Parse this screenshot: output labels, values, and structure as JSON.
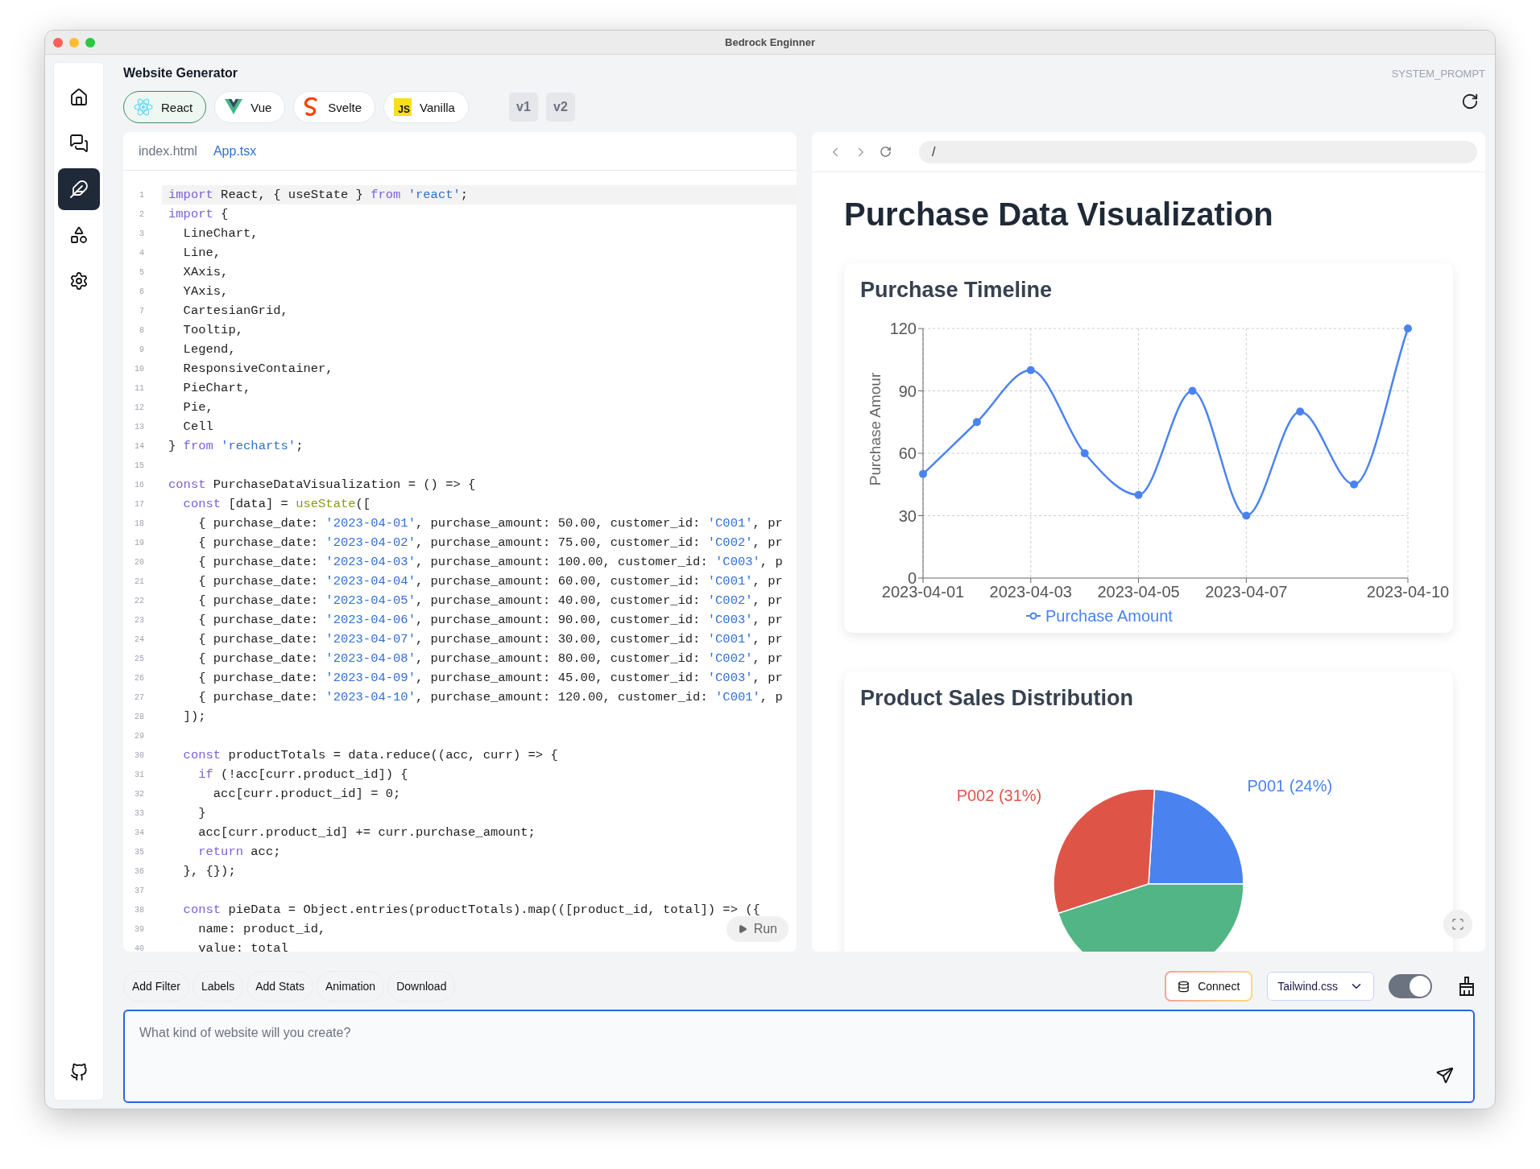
{
  "window": {
    "title": "Bedrock Enginner"
  },
  "sidebar": {
    "items": [
      {
        "selected": false
      },
      {
        "selected": false
      },
      {
        "selected": true
      },
      {
        "selected": false
      },
      {
        "selected": false
      }
    ]
  },
  "header": {
    "title": "Website Generator",
    "system_prompt": "SYSTEM_PROMPT"
  },
  "framework_tabs": [
    {
      "label": "React",
      "selected": true
    },
    {
      "label": "Vue",
      "selected": false
    },
    {
      "label": "Svelte",
      "selected": false
    },
    {
      "label": "Vanilla",
      "selected": false,
      "logo_text": "JS"
    }
  ],
  "versions": [
    "v1",
    "v2"
  ],
  "editor": {
    "files": [
      {
        "label": "index.html",
        "selected": false
      },
      {
        "label": "App.tsx",
        "selected": true
      }
    ],
    "lines": [
      {
        "n": "1",
        "active": true,
        "tokens": [
          {
            "kw": "import"
          },
          {
            "p": " React, { useState } "
          },
          {
            "kw": "from"
          },
          {
            "str": " 'react'"
          },
          {
            "p": ";"
          }
        ]
      },
      {
        "n": "2",
        "active": false,
        "tokens": [
          {
            "kw": "import"
          },
          {
            "p": " {"
          }
        ]
      },
      {
        "n": "3",
        "active": false,
        "tokens": [
          {
            "p": "  LineChart,"
          }
        ]
      },
      {
        "n": "4",
        "active": false,
        "tokens": [
          {
            "p": "  Line,"
          }
        ]
      },
      {
        "n": "5",
        "active": false,
        "tokens": [
          {
            "p": "  XAxis,"
          }
        ]
      },
      {
        "n": "6",
        "active": false,
        "tokens": [
          {
            "p": "  YAxis,"
          }
        ]
      },
      {
        "n": "7",
        "active": false,
        "tokens": [
          {
            "p": "  CartesianGrid,"
          }
        ]
      },
      {
        "n": "8",
        "active": false,
        "tokens": [
          {
            "p": "  Tooltip,"
          }
        ]
      },
      {
        "n": "9",
        "active": false,
        "tokens": [
          {
            "p": "  Legend,"
          }
        ]
      },
      {
        "n": "10",
        "active": false,
        "tokens": [
          {
            "p": "  ResponsiveContainer,"
          }
        ]
      },
      {
        "n": "11",
        "active": false,
        "tokens": [
          {
            "p": "  PieChart,"
          }
        ]
      },
      {
        "n": "12",
        "active": false,
        "tokens": [
          {
            "p": "  Pie,"
          }
        ]
      },
      {
        "n": "13",
        "active": false,
        "tokens": [
          {
            "p": "  Cell"
          }
        ]
      },
      {
        "n": "14",
        "active": false,
        "tokens": [
          {
            "p": "} "
          },
          {
            "kw": "from"
          },
          {
            "str": " 'recharts'"
          },
          {
            "p": ";"
          }
        ]
      },
      {
        "n": "15",
        "active": false
      },
      {
        "n": "16",
        "active": false,
        "tokens": [
          {
            "kw": "const"
          },
          {
            "p": " PurchaseDataVisualization = () => {"
          }
        ]
      },
      {
        "n": "17",
        "active": false,
        "tokens": [
          {
            "kw": "  const"
          },
          {
            "p": " [data] = "
          },
          {
            "fn": "useState"
          },
          {
            "p": "(["
          }
        ]
      },
      {
        "n": "18",
        "active": false,
        "tokens": [
          {
            "p": "    { purchase_date: "
          },
          {
            "str": "'2023-04-01'"
          },
          {
            "p": ", purchase_amount: 50.00, customer_id: "
          },
          {
            "str": "'C001'"
          },
          {
            "p": ", pr"
          }
        ]
      },
      {
        "n": "19",
        "active": false,
        "tokens": [
          {
            "p": "    { purchase_date: "
          },
          {
            "str": "'2023-04-02'"
          },
          {
            "p": ", purchase_amount: 75.00, customer_id: "
          },
          {
            "str": "'C002'"
          },
          {
            "p": ", pr"
          }
        ]
      },
      {
        "n": "20",
        "active": false,
        "tokens": [
          {
            "p": "    { purchase_date: "
          },
          {
            "str": "'2023-04-03'"
          },
          {
            "p": ", purchase_amount: 100.00, customer_id: "
          },
          {
            "str": "'C003'"
          },
          {
            "p": ", p"
          }
        ]
      },
      {
        "n": "21",
        "active": false,
        "tokens": [
          {
            "p": "    { purchase_date: "
          },
          {
            "str": "'2023-04-04'"
          },
          {
            "p": ", purchase_amount: 60.00, customer_id: "
          },
          {
            "str": "'C001'"
          },
          {
            "p": ", pr"
          }
        ]
      },
      {
        "n": "22",
        "active": false,
        "tokens": [
          {
            "p": "    { purchase_date: "
          },
          {
            "str": "'2023-04-05'"
          },
          {
            "p": ", purchase_amount: 40.00, customer_id: "
          },
          {
            "str": "'C002'"
          },
          {
            "p": ", pr"
          }
        ]
      },
      {
        "n": "23",
        "active": false,
        "tokens": [
          {
            "p": "    { purchase_date: "
          },
          {
            "str": "'2023-04-06'"
          },
          {
            "p": ", purchase_amount: 90.00, customer_id: "
          },
          {
            "str": "'C003'"
          },
          {
            "p": ", pr"
          }
        ]
      },
      {
        "n": "24",
        "active": false,
        "tokens": [
          {
            "p": "    { purchase_date: "
          },
          {
            "str": "'2023-04-07'"
          },
          {
            "p": ", purchase_amount: 30.00, customer_id: "
          },
          {
            "str": "'C001'"
          },
          {
            "p": ", pr"
          }
        ]
      },
      {
        "n": "25",
        "active": false,
        "tokens": [
          {
            "p": "    { purchase_date: "
          },
          {
            "str": "'2023-04-08'"
          },
          {
            "p": ", purchase_amount: 80.00, customer_id: "
          },
          {
            "str": "'C002'"
          },
          {
            "p": ", pr"
          }
        ]
      },
      {
        "n": "26",
        "active": false,
        "tokens": [
          {
            "p": "    { purchase_date: "
          },
          {
            "str": "'2023-04-09'"
          },
          {
            "p": ", purchase_amount: 45.00, customer_id: "
          },
          {
            "str": "'C003'"
          },
          {
            "p": ", pr"
          }
        ]
      },
      {
        "n": "27",
        "active": false,
        "tokens": [
          {
            "p": "    { purchase_date: "
          },
          {
            "str": "'2023-04-10'"
          },
          {
            "p": ", purchase_amount: 120.00, customer_id: "
          },
          {
            "str": "'C001'"
          },
          {
            "p": ", p"
          }
        ]
      },
      {
        "n": "28",
        "active": false,
        "tokens": [
          {
            "p": "  ]);"
          }
        ]
      },
      {
        "n": "29",
        "active": false
      },
      {
        "n": "30",
        "active": false,
        "tokens": [
          {
            "kw": "  const"
          },
          {
            "p": " productTotals = data.reduce((acc, curr) => {"
          }
        ]
      },
      {
        "n": "31",
        "active": false,
        "tokens": [
          {
            "kw": "    if"
          },
          {
            "p": " (!acc[curr.product_id]) {"
          }
        ]
      },
      {
        "n": "32",
        "active": false,
        "tokens": [
          {
            "p": "      acc[curr.product_id] = 0;"
          }
        ]
      },
      {
        "n": "33",
        "active": false,
        "tokens": [
          {
            "p": "    }"
          }
        ]
      },
      {
        "n": "34",
        "active": false,
        "tokens": [
          {
            "p": "    acc[curr.product_id] += curr.purchase_amount;"
          }
        ]
      },
      {
        "n": "35",
        "active": false,
        "tokens": [
          {
            "kw": "    return"
          },
          {
            "p": " acc;"
          }
        ]
      },
      {
        "n": "36",
        "active": false,
        "tokens": [
          {
            "p": "  }, {});"
          }
        ]
      },
      {
        "n": "37",
        "active": false
      },
      {
        "n": "38",
        "active": false,
        "tokens": [
          {
            "kw": "  const"
          },
          {
            "p": " pieData = Object.entries(productTotals).map(([product_id, total]) => ({"
          }
        ]
      },
      {
        "n": "39",
        "active": false,
        "tokens": [
          {
            "p": "    name: product_id,"
          }
        ]
      },
      {
        "n": "40",
        "active": false,
        "tokens": [
          {
            "p": "    value: total"
          }
        ]
      }
    ],
    "run_button": "Run"
  },
  "preview": {
    "url": "/",
    "heading": "Purchase Data Visualization",
    "timeline": {
      "title": "Purchase Timeline",
      "chart_data": {
        "type": "line",
        "ylabel": "Purchase Amour",
        "grid": true,
        "categories": [
          "2023-04-01",
          null,
          "2023-04-03",
          null,
          "2023-04-05",
          null,
          "2023-04-07",
          null,
          null,
          "2023-04-10"
        ],
        "series": [
          {
            "name": "Purchase Amount",
            "color": "#4a83f0",
            "marker": "o",
            "values": [
              50,
              75,
              100,
              60,
              40,
              90,
              30,
              80,
              45,
              120
            ]
          }
        ],
        "ylim": [
          0,
          120
        ],
        "yticks": [
          0,
          30,
          60,
          90,
          120
        ]
      }
    },
    "distribution": {
      "title": "Product Sales Distribution",
      "chart_data": {
        "type": "pie",
        "values": [
          24,
          31,
          45
        ],
        "colors": [
          "#4a83f0",
          "#de5548",
          "#52b585"
        ],
        "value_labels": [
          "P001 (24%)",
          "P002 (31%)",
          null
        ]
      }
    }
  },
  "suggestions": [
    "Add Filter",
    "Labels",
    "Add Stats",
    "Animation",
    "Download"
  ],
  "connect_button": "Connect",
  "style_select": "Tailwind.css",
  "toggle": {
    "on": true
  },
  "prompt": {
    "placeholder": "What kind of website will you create?"
  }
}
